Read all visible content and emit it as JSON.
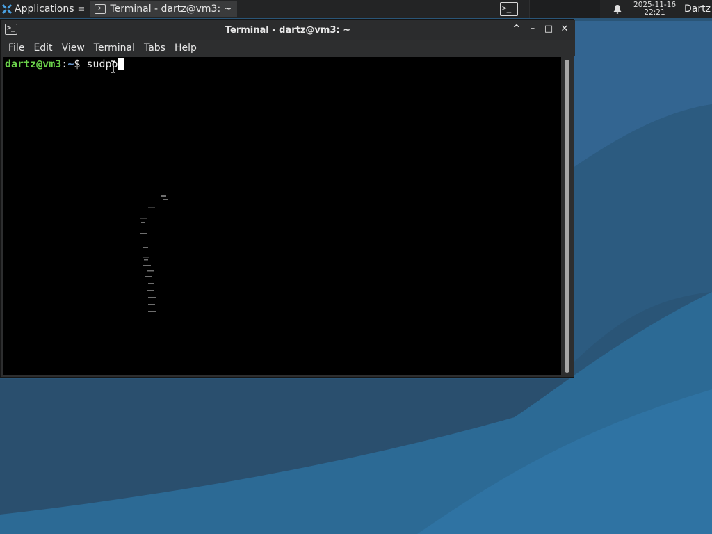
{
  "panel": {
    "apps_label": "Applications",
    "apps_separator": "≡",
    "task_label": "Terminal - dartz@vm3: ~",
    "launcher_glyph": ">_",
    "clock_date": "2025-11-16",
    "clock_time": "22:21",
    "user": "Dartz"
  },
  "window": {
    "title": "Terminal - dartz@vm3: ~",
    "icon_glyph": ">_",
    "buttons": {
      "shade": "^",
      "minimize": "–",
      "maximize": "□",
      "close": "✕"
    },
    "menu": [
      "File",
      "Edit",
      "View",
      "Terminal",
      "Tabs",
      "Help"
    ]
  },
  "terminal": {
    "prompt_user_host": "dartz@vm3",
    "prompt_colon": ":",
    "prompt_path": "~",
    "prompt_symbol": "$ ",
    "command_text": "sudpo"
  },
  "colors": {
    "panel_bg": "#232425",
    "window_bg": "#2d2e2f",
    "terminal_bg": "#000000",
    "prompt_user_color": "#6ad04a",
    "prompt_path_color": "#6a98d0",
    "wallpaper_base": "#2a5577"
  },
  "icons": [
    "xfce-logo-icon",
    "terminal-icon",
    "bell-icon",
    "text-cursor-icon"
  ]
}
